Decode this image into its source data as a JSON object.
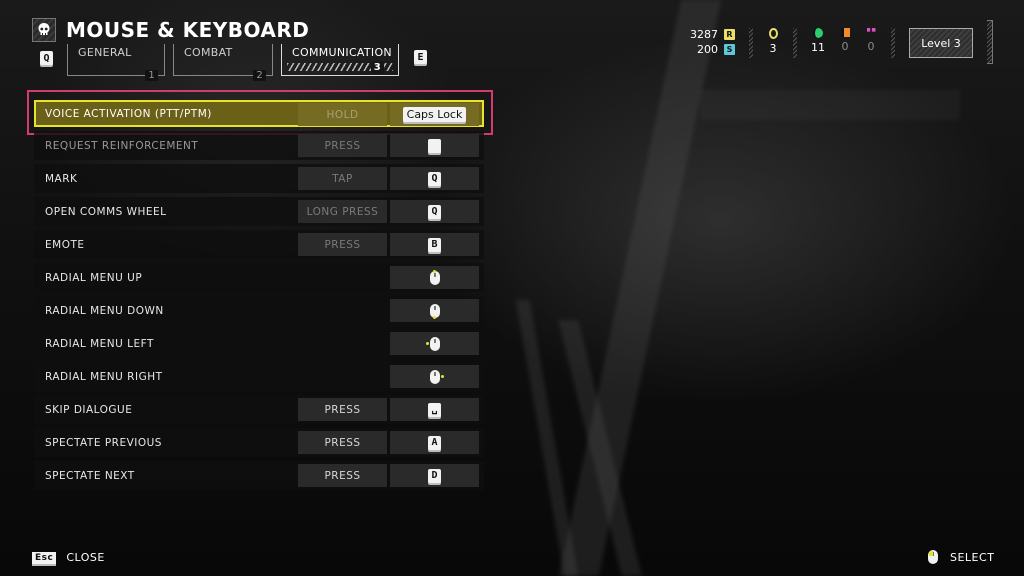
{
  "header": {
    "title": "MOUSE & KEYBOARD",
    "prev_tab_key": "Q",
    "next_tab_key": "E",
    "tabs": [
      {
        "label": "GENERAL",
        "number": "1",
        "active": false
      },
      {
        "label": "COMBAT",
        "number": "2",
        "active": false
      },
      {
        "label": "COMMUNICATION",
        "number": "3",
        "active": true
      }
    ]
  },
  "hud": {
    "requisition": "3287",
    "requisition_icon": "R",
    "super_credits": "200",
    "super_credits_icon": "S",
    "medals": "3",
    "samples_common": "11",
    "samples_rare": "0",
    "samples_super": "0",
    "level": "Level 3",
    "colors": {
      "requisition": "#e8e06a",
      "super_credits": "#5fc8d8",
      "medals": "#e8e06a",
      "samples_common": "#2ecc71",
      "samples_rare": "#f08a2a",
      "samples_super": "#e050c8"
    }
  },
  "bindings": [
    {
      "action": "VOICE ACTIVATION (PTT/PTM)",
      "mode": "HOLD",
      "key": "Caps Lock",
      "key_type": "text",
      "selected": true
    },
    {
      "action": "REQUEST REINFORCEMENT",
      "mode": "PRESS",
      "key": "",
      "key_type": "blank",
      "dim": true
    },
    {
      "action": "MARK",
      "mode": "TAP",
      "key": "Q",
      "key_type": "key",
      "mode_dim": true
    },
    {
      "action": "OPEN COMMS WHEEL",
      "mode": "LONG PRESS",
      "key": "Q",
      "key_type": "key",
      "mode_dim": true
    },
    {
      "action": "EMOTE",
      "mode": "PRESS",
      "key": "B",
      "key_type": "key",
      "mode_dim": true
    },
    {
      "action": "RADIAL MENU UP",
      "mode": "",
      "key": "mouse-up",
      "key_type": "mouse"
    },
    {
      "action": "RADIAL MENU DOWN",
      "mode": "",
      "key": "mouse-down",
      "key_type": "mouse"
    },
    {
      "action": "RADIAL MENU LEFT",
      "mode": "",
      "key": "mouse-left",
      "key_type": "mouse"
    },
    {
      "action": "RADIAL MENU RIGHT",
      "mode": "",
      "key": "mouse-right",
      "key_type": "mouse"
    },
    {
      "action": "SKIP DIALOGUE",
      "mode": "PRESS",
      "key": "␣",
      "key_type": "key"
    },
    {
      "action": "SPECTATE PREVIOUS",
      "mode": "PRESS",
      "key": "A",
      "key_type": "key"
    },
    {
      "action": "SPECTATE NEXT",
      "mode": "PRESS",
      "key": "D",
      "key_type": "key"
    }
  ],
  "footer": {
    "close_key": "Esc",
    "close_label": "CLOSE",
    "select_label": "SELECT"
  },
  "accent": {
    "selection": "#e8e42a",
    "focus_ring": "#d33a6e"
  }
}
